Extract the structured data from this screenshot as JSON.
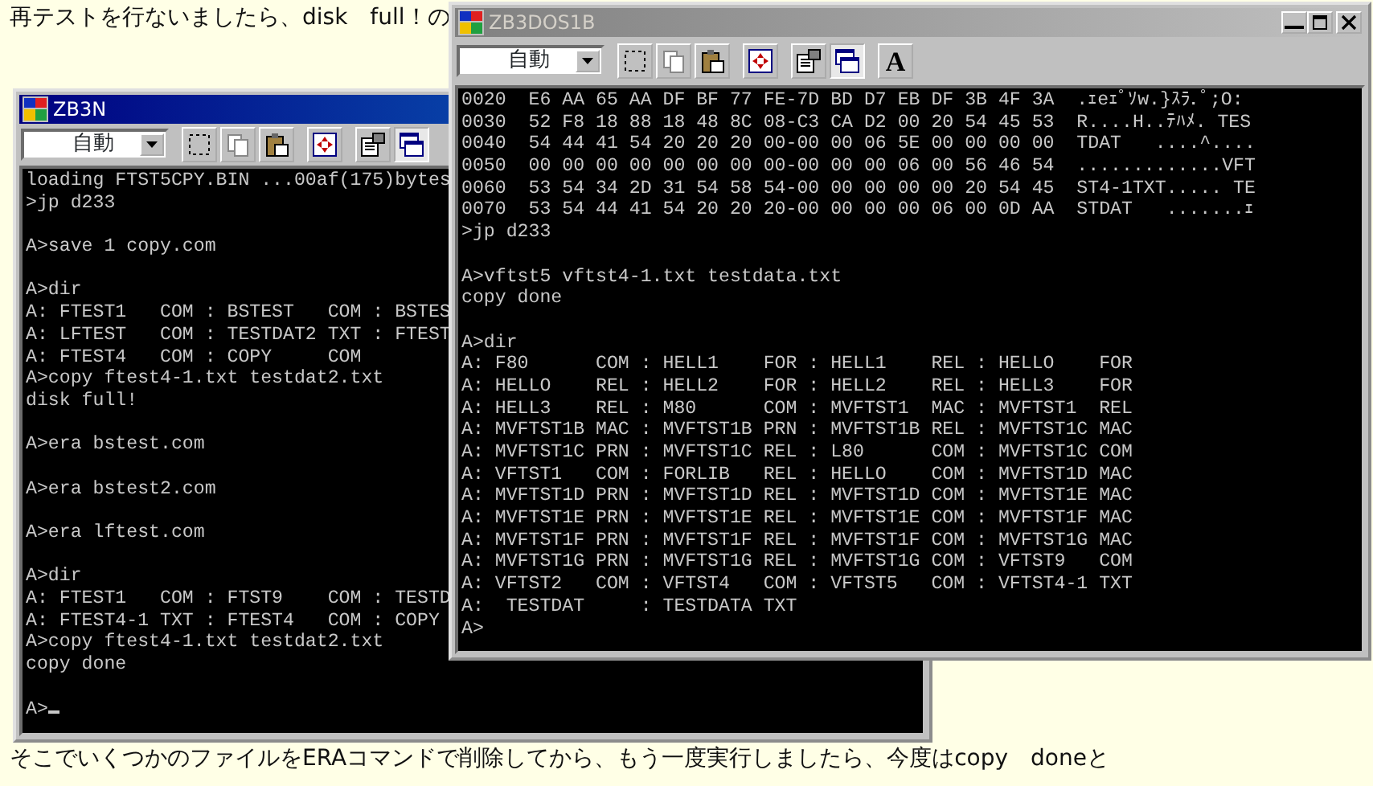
{
  "intro": "再テストを行ないましたら、disk　full！の",
  "windows": [
    {
      "title": "ZB3N",
      "active": true,
      "font_mode": "自動",
      "cursor": true,
      "tools": [
        {
          "kind": "mark",
          "pressed": false
        },
        {
          "kind": "copy",
          "pressed": false
        },
        {
          "kind": "paste",
          "pressed": false
        },
        {
          "kind": "fullscreen",
          "pressed": false
        },
        {
          "kind": "properties",
          "pressed": false
        },
        {
          "kind": "background",
          "pressed": true
        }
      ],
      "lines": [
        {
          "text": "loading FTST5CPY.BIN ...00af(175)bytes"
        },
        {
          "text": ">jp d233"
        },
        {
          "text": "A>save 1 copy.com",
          "spaced": true
        },
        {
          "text": "A>dir",
          "spaced": true
        },
        {
          "text": "A: FTEST1   COM : BSTEST   COM : BSTES"
        },
        {
          "text": "A: LFTEST   COM : TESTDAT2 TXT : FTEST"
        },
        {
          "text": "A: FTEST4   COM : COPY     COM"
        },
        {
          "text": "A>copy ftest4-1.txt testdat2.txt"
        },
        {
          "text": "disk full!"
        },
        {
          "text": "A>era bstest.com",
          "spaced": true
        },
        {
          "text": "A>era bstest2.com",
          "spaced": true
        },
        {
          "text": "A>era lftest.com",
          "spaced": true
        },
        {
          "text": "A>dir",
          "spaced": true
        },
        {
          "text": "A: FTEST1   COM : FTST9    COM : TESTD"
        },
        {
          "text": "A: FTEST4-1 TXT : FTEST4   COM : COPY"
        },
        {
          "text": "A>copy ftest4-1.txt testdat2.txt"
        },
        {
          "text": "copy done"
        },
        {
          "text": "A>",
          "spaced": true
        }
      ]
    },
    {
      "title": "ZB3DOS1B",
      "active": false,
      "caption_buttons": true,
      "font_mode": "自動",
      "tools": [
        {
          "kind": "mark",
          "pressed": false
        },
        {
          "kind": "copy",
          "pressed": false
        },
        {
          "kind": "paste",
          "pressed": false
        },
        {
          "kind": "fullscreen",
          "pressed": false
        },
        {
          "kind": "properties",
          "pressed": false
        },
        {
          "kind": "background",
          "pressed": true
        },
        {
          "kind": "font",
          "pressed": false,
          "label": "A"
        }
      ],
      "lines": [
        {
          "text": "0020  E6 AA 65 AA DF BF 77 FE-7D BD D7 EB DF 3B 4F 3A  .ｪeｪﾟｿw.}ｽﾗ.ﾟ;O:"
        },
        {
          "text": "0030  52 F8 18 88 18 48 8C 08-C3 CA D2 00 20 54 45 53  R....H..ﾃﾊﾒ. TES"
        },
        {
          "text": "0040  54 44 41 54 20 20 20 00-00 00 06 5E 00 00 00 00  TDAT   ....^...."
        },
        {
          "text": "0050  00 00 00 00 00 00 00 00-00 00 00 06 00 56 46 54  .............VFT"
        },
        {
          "text": "0060  53 54 34 2D 31 54 58 54-00 00 00 00 00 20 54 45  ST4-1TXT..... TE"
        },
        {
          "text": "0070  53 54 44 41 54 20 20 20-00 00 00 00 06 00 0D AA  STDAT   .......ｪ"
        },
        {
          "text": ">jp d233"
        },
        {
          "text": "A>vftst5 vftst4-1.txt testdata.txt",
          "spaced": true
        },
        {
          "text": "copy done"
        },
        {
          "text": "A>dir",
          "spaced": true
        },
        {
          "text": "A: F80      COM : HELL1    FOR : HELL1    REL : HELLO    FOR"
        },
        {
          "text": "A: HELLO    REL : HELL2    FOR : HELL2    REL : HELL3    FOR"
        },
        {
          "text": "A: HELL3    REL : M80      COM : MVFTST1  MAC : MVFTST1  REL"
        },
        {
          "text": "A: MVFTST1B MAC : MVFTST1B PRN : MVFTST1B REL : MVFTST1C MAC"
        },
        {
          "text": "A: MVFTST1C PRN : MVFTST1C REL : L80      COM : MVFTST1C COM"
        },
        {
          "text": "A: VFTST1   COM : FORLIB   REL : HELLO    COM : MVFTST1D MAC"
        },
        {
          "text": "A: MVFTST1D PRN : MVFTST1D REL : MVFTST1D COM : MVFTST1E MAC"
        },
        {
          "text": "A: MVFTST1E PRN : MVFTST1E REL : MVFTST1E COM : MVFTST1F MAC"
        },
        {
          "text": "A: MVFTST1F PRN : MVFTST1F REL : MVFTST1F COM : MVFTST1G MAC"
        },
        {
          "text": "A: MVFTST1G PRN : MVFTST1G REL : MVFTST1G COM : VFTST9   COM"
        },
        {
          "text": "A: VFTST2   COM : VFTST4   COM : VFTST5   COM : VFTST4-1 TXT"
        },
        {
          "text": "A:  TESTDAT     : TESTDATA TXT"
        },
        {
          "text": "A>"
        }
      ]
    }
  ],
  "outro": "そこでいくつかのファイルをERAコマンドで削除してから、もう一度実行しましたら、今度はcopy　doneと"
}
